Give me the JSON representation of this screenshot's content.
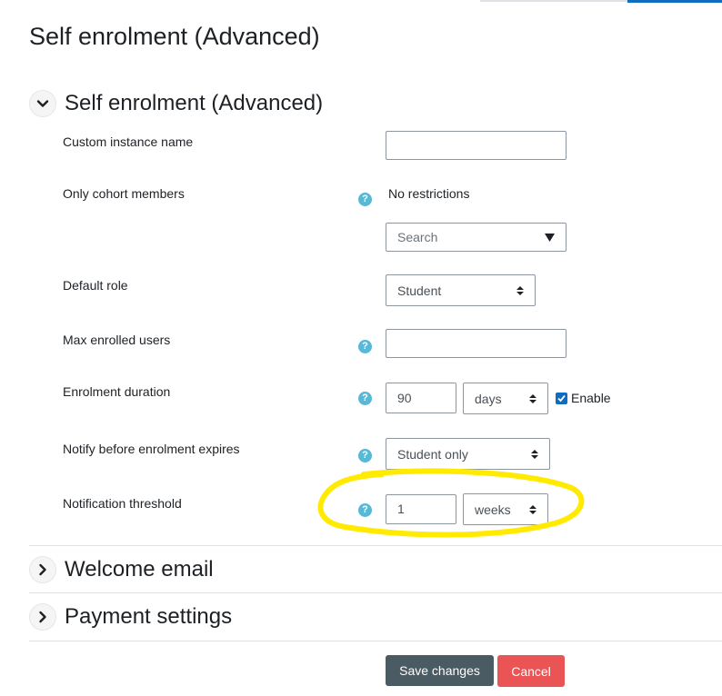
{
  "page": {
    "title": "Self enrolment (Advanced)"
  },
  "sections": {
    "general": {
      "title": "Self enrolment (Advanced)"
    },
    "welcome_email": {
      "title": "Welcome email"
    },
    "payment_settings": {
      "title": "Payment settings"
    }
  },
  "form": {
    "custom_instance_name": {
      "label": "Custom instance name",
      "value": ""
    },
    "only_cohort_members": {
      "label": "Only cohort members",
      "current": "No restrictions",
      "search_placeholder": "Search"
    },
    "default_role": {
      "label": "Default role",
      "selected": "Student"
    },
    "max_enrolled_users": {
      "label": "Max enrolled users",
      "value": ""
    },
    "enrolment_duration": {
      "label": "Enrolment duration",
      "value": "90",
      "unit": "days",
      "enable_label": "Enable",
      "enabled": true
    },
    "notify_before_expires": {
      "label": "Notify before enrolment expires",
      "selected": "Student only"
    },
    "notification_threshold": {
      "label": "Notification threshold",
      "value": "1",
      "unit": "weeks"
    }
  },
  "buttons": {
    "save": "Save changes",
    "cancel": "Cancel"
  },
  "icons": {
    "help": "question-circle-icon",
    "expanded": "chevron-down-icon",
    "collapsed": "chevron-right-icon",
    "dropdown": "caret-down-icon",
    "select": "sort-arrows-icon"
  },
  "colors": {
    "help_icon": "#58b8d6",
    "primary_button": "#4b5b63",
    "cancel_button": "#ea5454",
    "checkbox": "#0f6cbf",
    "highlight": "#ffea00"
  }
}
